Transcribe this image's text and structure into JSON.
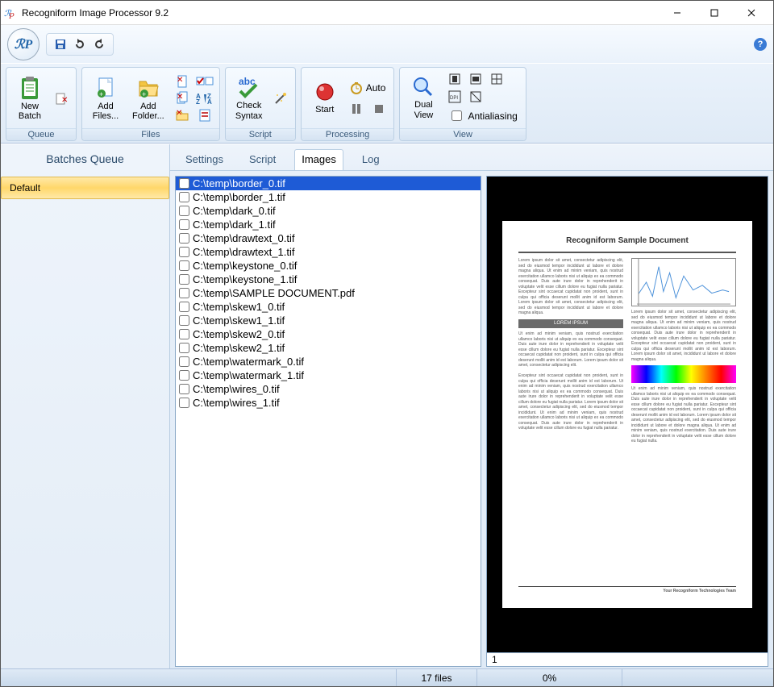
{
  "window": {
    "title": "Recogniform Image Processor 9.2"
  },
  "ribbon": {
    "groups": {
      "queue": {
        "label": "Queue",
        "newBatch": "New\nBatch"
      },
      "files": {
        "label": "Files",
        "addFiles": "Add\nFiles...",
        "addFolder": "Add\nFolder..."
      },
      "script": {
        "label": "Script",
        "checkSyntax": "Check\nSyntax"
      },
      "processing": {
        "label": "Processing",
        "start": "Start",
        "auto": "Auto"
      },
      "view": {
        "label": "View",
        "dualView": "Dual\nView",
        "antialiasing": "Antialiasing"
      }
    }
  },
  "leftPanel": {
    "header": "Batches  Queue",
    "items": [
      "Default"
    ],
    "selectedIndex": 0
  },
  "tabs": {
    "items": [
      "Settings",
      "Script",
      "Images",
      "Log"
    ],
    "activeIndex": 2
  },
  "files": {
    "selectedIndex": 0,
    "items": [
      "C:\\temp\\border_0.tif",
      "C:\\temp\\border_1.tif",
      "C:\\temp\\dark_0.tif",
      "C:\\temp\\dark_1.tif",
      "C:\\temp\\drawtext_0.tif",
      "C:\\temp\\drawtext_1.tif",
      "C:\\temp\\keystone_0.tif",
      "C:\\temp\\keystone_1.tif",
      "C:\\temp\\SAMPLE DOCUMENT.pdf",
      "C:\\temp\\skew1_0.tif",
      "C:\\temp\\skew1_1.tif",
      "C:\\temp\\skew2_0.tif",
      "C:\\temp\\skew2_1.tif",
      "C:\\temp\\watermark_0.tif",
      "C:\\temp\\watermark_1.tif",
      "C:\\temp\\wires_0.tif",
      "C:\\temp\\wires_1.tif"
    ]
  },
  "preview": {
    "pageNumber": "1",
    "doc": {
      "title": "Recogniform Sample Document",
      "section": "LOREM IPSUM",
      "signature": "Your Recogniform Technologies Team"
    }
  },
  "status": {
    "fileCount": "17 files",
    "progress": "0%"
  },
  "icons": {
    "save": "save-icon",
    "redo": "redo-icon",
    "undo": "undo-icon",
    "help": "?",
    "appMono": "ℛP"
  }
}
